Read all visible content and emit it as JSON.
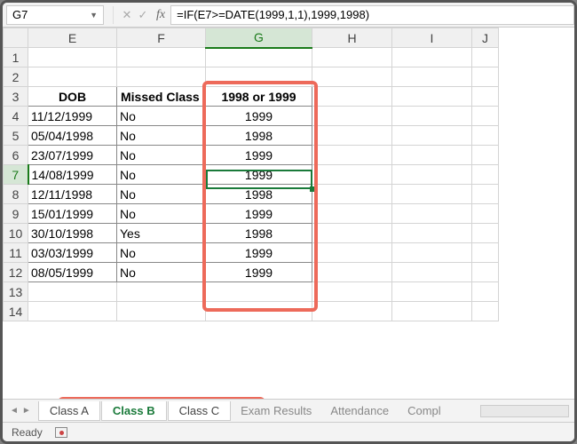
{
  "namebox": "G7",
  "formula": "=IF(E7>=DATE(1999,1,1),1999,1998)",
  "fx_label": "fx",
  "columns": [
    "E",
    "F",
    "G",
    "H",
    "I",
    "J"
  ],
  "active_col": "G",
  "active_row": 7,
  "headers": {
    "E": "DOB",
    "F": "Missed Class",
    "G": "1998 or 1999"
  },
  "rows": [
    {
      "n": 4,
      "E": "11/12/1999",
      "F": "No",
      "G": "1999"
    },
    {
      "n": 5,
      "E": "05/04/1998",
      "F": "No",
      "G": "1998"
    },
    {
      "n": 6,
      "E": "23/07/1999",
      "F": "No",
      "G": "1999"
    },
    {
      "n": 7,
      "E": "14/08/1999",
      "F": "No",
      "G": "1999"
    },
    {
      "n": 8,
      "E": "12/11/1998",
      "F": "No",
      "G": "1998"
    },
    {
      "n": 9,
      "E": "15/01/1999",
      "F": "No",
      "G": "1999"
    },
    {
      "n": 10,
      "E": "30/10/1998",
      "F": "Yes",
      "G": "1998"
    },
    {
      "n": 11,
      "E": "03/03/1999",
      "F": "No",
      "G": "1999"
    },
    {
      "n": 12,
      "E": "08/05/1999",
      "F": "No",
      "G": "1999"
    }
  ],
  "tabs": {
    "classA": "Class A",
    "classB": "Class B",
    "classC": "Class C",
    "exam": "Exam Results",
    "attendance": "Attendance",
    "compl": "Compl"
  },
  "status": "Ready"
}
